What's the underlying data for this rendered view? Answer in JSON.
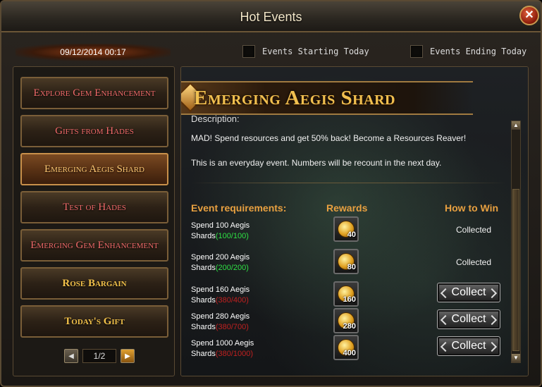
{
  "window": {
    "title": "Hot Events",
    "close_label": "✕"
  },
  "time": "09/12/2014 00:17",
  "filters": [
    {
      "label": "Events Starting Today",
      "checked": false
    },
    {
      "label": "Events Ending Today",
      "checked": false
    }
  ],
  "sidebar": {
    "items": [
      {
        "label": "Explore Gem Enhancement"
      },
      {
        "label": "Gifts from Hades"
      },
      {
        "label": "Emerging Aegis Shard"
      },
      {
        "label": "Test of Hades"
      },
      {
        "label": "Emerging Gem Enhancement"
      },
      {
        "label": "Rose Bargain"
      },
      {
        "label": "Today's Gift"
      }
    ],
    "active_index": 2,
    "pager": {
      "prev_icon": "◀",
      "next_icon": "▶",
      "page": "1/2"
    }
  },
  "event": {
    "title": "Emerging Aegis Shard",
    "description_label": "Description:",
    "description_lines": [
      "MAD! Spend resources and get 50% back! Become a Resources Reaver!",
      "This is an everyday event. Numbers will be recount in the next day."
    ],
    "columns": {
      "requirements": "Event requirements:",
      "rewards": "Rewards",
      "how_to_win": "How to Win"
    },
    "rows": [
      {
        "line1": "Spend 100 Aegis",
        "line2": "Shards",
        "progress": "(100/100)",
        "complete": true,
        "reward_qty": "40",
        "status": "Collected"
      },
      {
        "line1": "Spend 200 Aegis",
        "line2": "Shards",
        "progress": "(200/200)",
        "complete": true,
        "reward_qty": "80",
        "status": "Collected"
      },
      {
        "line1": "Spend 160 Aegis",
        "line2": "Shards",
        "progress": "(380/400)",
        "complete": false,
        "reward_qty": "160",
        "status": "Collect"
      },
      {
        "line1": "Spend 280 Aegis",
        "line2": "Shards",
        "progress": "(380/700)",
        "complete": false,
        "reward_qty": "280",
        "status": "Collect"
      },
      {
        "line1": "Spend 1000 Aegis",
        "line2": "Shards",
        "progress": "(380/1000)",
        "complete": false,
        "reward_qty": "400",
        "status": "Collect"
      }
    ]
  },
  "colors": {
    "accent": "#e8a040",
    "title_gold": "#f0c050",
    "progress_ok": "#2ee044",
    "progress_bad": "#c02020"
  }
}
